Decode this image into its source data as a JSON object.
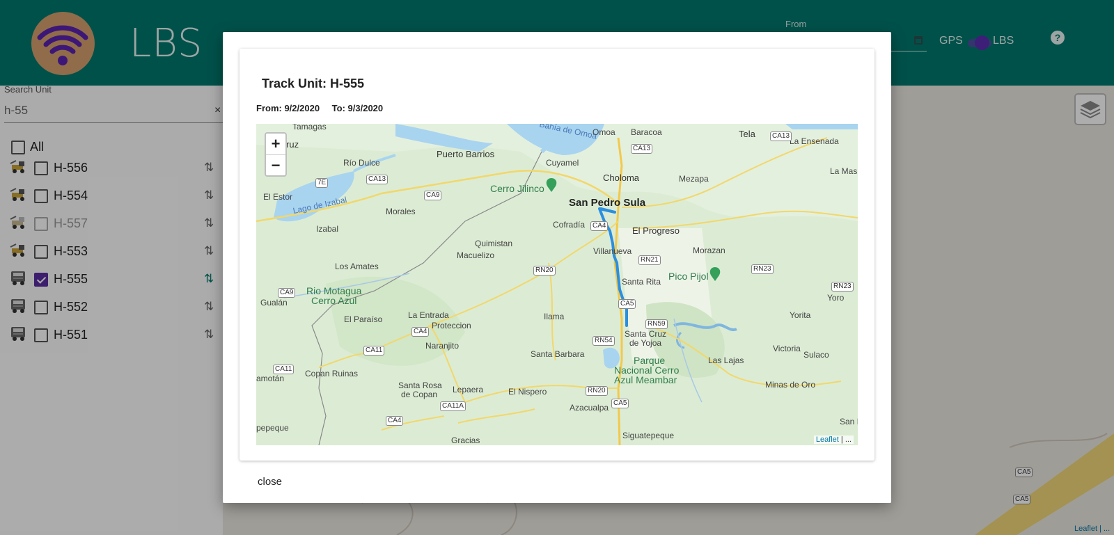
{
  "header": {
    "app_title": "LBS",
    "from_label": "From",
    "gps_label": "GPS",
    "lbs_label": "LBS",
    "help_label": "?"
  },
  "sidebar": {
    "search_label": "Search Unit",
    "search_value": "h-55",
    "clear_label": "×",
    "all_label": "All",
    "units": [
      {
        "label": "H-556",
        "icon": "loader-truck-icon",
        "checked": false,
        "disabled": false
      },
      {
        "label": "H-554",
        "icon": "loader-truck-icon",
        "checked": false,
        "disabled": false
      },
      {
        "label": "H-557",
        "icon": "loader-truck-icon",
        "checked": false,
        "disabled": true
      },
      {
        "label": "H-553",
        "icon": "loader-truck-icon",
        "checked": false,
        "disabled": false
      },
      {
        "label": "H-555",
        "icon": "truck-icon",
        "checked": true,
        "disabled": false
      },
      {
        "label": "H-552",
        "icon": "truck-icon",
        "checked": false,
        "disabled": false
      },
      {
        "label": "H-551",
        "icon": "truck-icon",
        "checked": false,
        "disabled": false
      }
    ]
  },
  "background_map": {
    "attribution": "Leaflet | ...",
    "road_shields": [
      "CA5",
      "CA5"
    ]
  },
  "modal": {
    "title": "Track Unit: H-555",
    "from_text": "From: 9/2/2020",
    "to_text": "To: 9/3/2020",
    "zoom_in": "+",
    "zoom_out": "−",
    "attribution_link": "Leaflet",
    "attribution_rest": " | ...",
    "close_label": "close",
    "map_labels": {
      "tamagas": "Tamagas",
      "santa_cruz_w": "nta Cruz",
      "rio_dulce": "Río Dulce",
      "el_estor": "El Estor",
      "lago_izabal": "Lago de Izabal",
      "izabal": "Izabal",
      "morales": "Morales",
      "puerto_barrios": "Puerto Barrios",
      "bahia_omoa": "Bahía de Omoa",
      "omoa": "Omoa",
      "baracoa": "Baracoa",
      "tela": "Tela",
      "la_ensenada": "La Ensenada",
      "la_masica": "La Masic",
      "cuyamel": "Cuyamel",
      "choloma": "Choloma",
      "mezapa": "Mezapa",
      "cerro_jilinco": "Cerro Jilinco",
      "san_pedro_sula": "San Pedro Sula",
      "cofradia": "Cofradía",
      "el_progreso": "El Progreso",
      "quimistan": "Quimistan",
      "macuelizo": "Macuelizo",
      "villanueva": "Villanueva",
      "morazan": "Morazan",
      "los_amates": "Los Amates",
      "pico_pijol": "Pico Pijol",
      "santa_rita": "Santa Rita",
      "rio_motagua": "Rio Motagua",
      "cerro_azul": "Cerro Azul",
      "gualan": "Gualán",
      "yoro": "Yoro",
      "la_entrada": "La Entrada",
      "el_paraiso": "El Paraíso",
      "proteccion": "Proteccion",
      "ilama": "Ilama",
      "yorita": "Yorita",
      "santa_cruz_yojoa_1": "Santa Cruz",
      "santa_cruz_yojoa_2": "de Yojoa",
      "naranjito": "Naranjito",
      "santa_barbara": "Santa Barbara",
      "parque_1": "Parque",
      "parque_2": "Nacional Cerro",
      "parque_3": "Azul Meambar",
      "victoria": "Victoria",
      "las_lajas": "Las Lajas",
      "sulaco": "Sulaco",
      "camotan": "amotán",
      "copan_ruinas": "Copan Ruinas",
      "santa_rosa_1": "Santa Rosa",
      "santa_rosa_2": "de Copan",
      "lepaera": "Lepaera",
      "el_nispero": "El Nispero",
      "azacualpa": "Azacualpa",
      "minas_de_oro": "Minas de Oro",
      "san_i": "San I",
      "pepeque": "pepeque",
      "siguatepeque": "Siguatepeque",
      "gracias": "Gracias"
    },
    "road_shields": {
      "ca13_a": "CA13",
      "ca13_b": "CA13",
      "ca13_c": "CA13",
      "s7e": "7E",
      "ca9_a": "CA9",
      "ca9_b": "CA9",
      "ca4_a": "CA4",
      "ca4_b": "CA4",
      "ca4_c": "CA4",
      "rn20_a": "RN20",
      "rn20_b": "RN20",
      "rn21": "RN21",
      "rn23_a": "RN23",
      "rn23_b": "RN23",
      "ca5_a": "CA5",
      "ca5_b": "CA5",
      "rn59": "RN59",
      "rn54": "RN54",
      "ca11_a": "CA11",
      "ca11_b": "CA11",
      "ca11a": "CA11A"
    }
  }
}
